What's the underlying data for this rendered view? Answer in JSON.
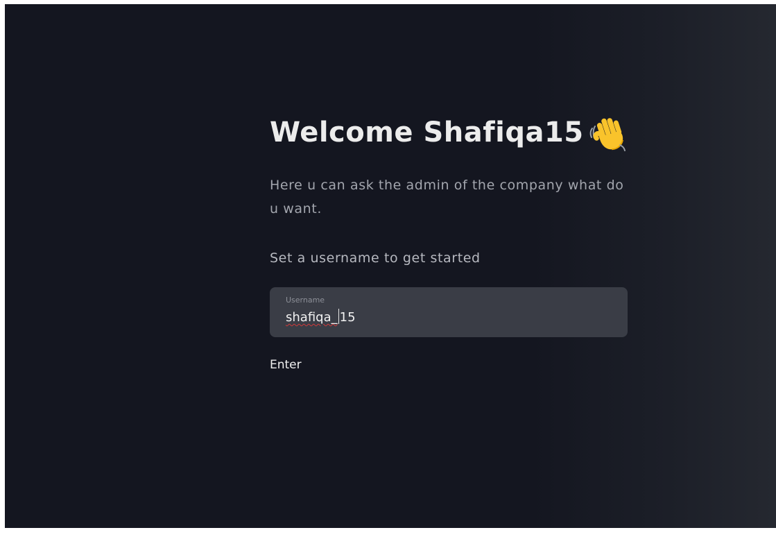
{
  "welcome": {
    "title": "Welcome Shafiqa15",
    "subtitle": "Here u can ask the admin of the company what do u want.",
    "prompt": "Set a username to get started"
  },
  "username_field": {
    "label": "Username",
    "value_before_caret": "shafiqa_",
    "value_after_caret": "15"
  },
  "enter_button": {
    "label": "Enter"
  },
  "icons": {
    "greeting": "waving-hand-icon"
  },
  "colors": {
    "background": "#141620",
    "field_background": "#3a3d46",
    "title_text": "#ececec",
    "muted_text": "#a3a6ae"
  }
}
